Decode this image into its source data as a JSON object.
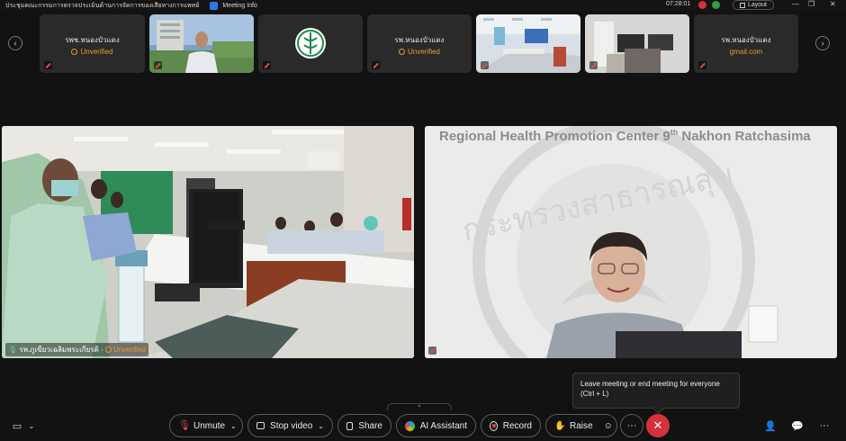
{
  "titlebar": {
    "title": "ประชุมคณะกรรมการตรวจประเมินด้านการจัดการของเสียทางการแพทย์",
    "meeting_info": "Meeting Info",
    "time": "07:28:01",
    "layout_label": "Layout"
  },
  "thumbnails": [
    {
      "name": "รพช.หนองบัวแดง",
      "status": "Unverified"
    },
    {
      "name": "",
      "status": ""
    },
    {
      "name": "",
      "status": ""
    },
    {
      "name": "รพ.หนองบัวแดง",
      "status": "Unverified"
    },
    {
      "name": "",
      "status": ""
    },
    {
      "name": "",
      "status": ""
    },
    {
      "name": "รพ.หนองบัวแดง",
      "email": "gmail.com"
    }
  ],
  "main_tiles": {
    "left": {
      "name": "รพ.ภูเขียวเฉลิมพระเกียรติ",
      "status": "Unverified"
    },
    "right": {
      "banner": "Regional Health Promotion Center 9",
      "banner_sup": "th",
      "banner_tail": " Nakhon Ratchasima"
    }
  },
  "tooltip": {
    "line1": "Leave meeting or end meeting for everyone",
    "line2": "(Ctrl + L)"
  },
  "toolbar": {
    "unmute": "Unmute",
    "stop_video": "Stop video",
    "share": "Share",
    "ai_assistant": "AI Assistant",
    "record": "Record",
    "raise": "Raise",
    "more": "···"
  },
  "colors": {
    "accent_leave": "#d6323c",
    "unverified": "#e89b2a",
    "mic_muted": "#e24c4c",
    "record_red": "#e04646"
  }
}
